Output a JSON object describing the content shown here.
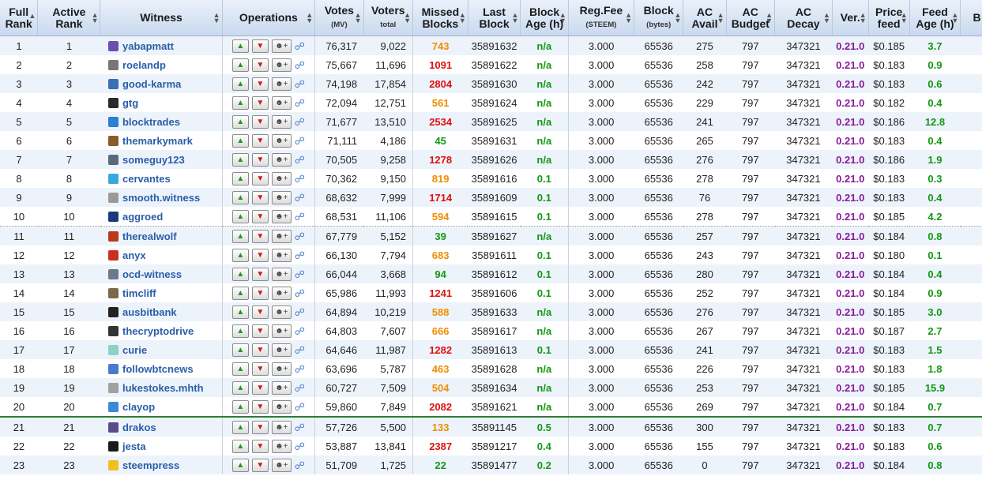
{
  "headers": [
    {
      "l1": "Full",
      "l2": "Rank",
      "sub": "",
      "sort": "up"
    },
    {
      "l1": "Active",
      "l2": "Rank",
      "sub": "",
      "sort": "both"
    },
    {
      "l1": "Witness",
      "l2": "",
      "sub": "",
      "sort": "both"
    },
    {
      "l1": "Operations",
      "l2": "",
      "sub": "",
      "sort": "both"
    },
    {
      "l1": "Votes",
      "l2": "",
      "sub": "(MV)",
      "sort": "both"
    },
    {
      "l1": "Voters",
      "l2": "",
      "sub": "total",
      "sort": "both"
    },
    {
      "l1": "Missed",
      "l2": "Blocks",
      "sub": "",
      "sort": "both"
    },
    {
      "l1": "Last",
      "l2": "Block",
      "sub": "",
      "sort": "both"
    },
    {
      "l1": "Block",
      "l2": "Age (h)",
      "sub": "",
      "sort": "both"
    },
    {
      "l1": "Reg.Fee",
      "l2": "",
      "sub": "(STEEM)",
      "sort": "both"
    },
    {
      "l1": "Block",
      "l2": "",
      "sub": "(bytes)",
      "sort": "both"
    },
    {
      "l1": "AC",
      "l2": "Avail",
      "sub": "",
      "sort": "both"
    },
    {
      "l1": "AC",
      "l2": "Budget",
      "sub": "",
      "sort": "both"
    },
    {
      "l1": "AC",
      "l2": "Decay",
      "sub": "",
      "sort": "both"
    },
    {
      "l1": "Ver.",
      "l2": "",
      "sub": "",
      "sort": "both"
    },
    {
      "l1": "Price",
      "l2": "feed",
      "sub": "",
      "sort": "both"
    },
    {
      "l1": "Feed",
      "l2": "Age (h)",
      "sub": "",
      "sort": "both"
    },
    {
      "l1": "B",
      "l2": "",
      "sub": "",
      "sort": ""
    }
  ],
  "colors": {
    "missed_orange": "#f08c00",
    "missed_red": "#e01010",
    "missed_green": "#129812",
    "version": "#8a1a9a",
    "link": "#2a5ea8"
  },
  "rows": [
    {
      "full": "1",
      "active": "1",
      "witness": "yabapmatt",
      "icon": "#6a4fb0",
      "votes": "76,317",
      "voters": "9,022",
      "missed": "743",
      "mc": "orange",
      "last": "35891632",
      "age": "n/a",
      "fee": "3.000",
      "block": "65536",
      "avail": "275",
      "budget": "797",
      "decay": "347321",
      "ver": "0.21.0",
      "price": "$0.185",
      "feed": "3.7"
    },
    {
      "full": "2",
      "active": "2",
      "witness": "roelandp",
      "icon": "#777777",
      "votes": "75,667",
      "voters": "11,696",
      "missed": "1091",
      "mc": "red",
      "last": "35891622",
      "age": "n/a",
      "fee": "3.000",
      "block": "65536",
      "avail": "258",
      "budget": "797",
      "decay": "347321",
      "ver": "0.21.0",
      "price": "$0.183",
      "feed": "0.9"
    },
    {
      "full": "3",
      "active": "3",
      "witness": "good-karma",
      "icon": "#3a6fb8",
      "votes": "74,198",
      "voters": "17,854",
      "missed": "2804",
      "mc": "red",
      "last": "35891630",
      "age": "n/a",
      "fee": "3.000",
      "block": "65536",
      "avail": "242",
      "budget": "797",
      "decay": "347321",
      "ver": "0.21.0",
      "price": "$0.183",
      "feed": "0.6"
    },
    {
      "full": "4",
      "active": "4",
      "witness": "gtg",
      "icon": "#2a2a2a",
      "votes": "72,094",
      "voters": "12,751",
      "missed": "561",
      "mc": "orange",
      "last": "35891624",
      "age": "n/a",
      "fee": "3.000",
      "block": "65536",
      "avail": "229",
      "budget": "797",
      "decay": "347321",
      "ver": "0.21.0",
      "price": "$0.182",
      "feed": "0.4"
    },
    {
      "full": "5",
      "active": "5",
      "witness": "blocktrades",
      "icon": "#2d7fd2",
      "votes": "71,677",
      "voters": "13,510",
      "missed": "2534",
      "mc": "red",
      "last": "35891625",
      "age": "n/a",
      "fee": "3.000",
      "block": "65536",
      "avail": "241",
      "budget": "797",
      "decay": "347321",
      "ver": "0.21.0",
      "price": "$0.186",
      "feed": "12.8"
    },
    {
      "full": "6",
      "active": "6",
      "witness": "themarkymark",
      "icon": "#8a5a2a",
      "votes": "71,111",
      "voters": "4,186",
      "missed": "45",
      "mc": "green",
      "last": "35891631",
      "age": "n/a",
      "fee": "3.000",
      "block": "65536",
      "avail": "265",
      "budget": "797",
      "decay": "347321",
      "ver": "0.21.0",
      "price": "$0.183",
      "feed": "0.4"
    },
    {
      "full": "7",
      "active": "7",
      "witness": "someguy123",
      "icon": "#5a6a7a",
      "votes": "70,505",
      "voters": "9,258",
      "missed": "1278",
      "mc": "red",
      "last": "35891626",
      "age": "n/a",
      "fee": "3.000",
      "block": "65536",
      "avail": "276",
      "budget": "797",
      "decay": "347321",
      "ver": "0.21.0",
      "price": "$0.186",
      "feed": "1.9"
    },
    {
      "full": "8",
      "active": "8",
      "witness": "cervantes",
      "icon": "#3aa8e0",
      "votes": "70,362",
      "voters": "9,150",
      "missed": "819",
      "mc": "orange",
      "last": "35891616",
      "age": "0.1",
      "fee": "3.000",
      "block": "65536",
      "avail": "278",
      "budget": "797",
      "decay": "347321",
      "ver": "0.21.0",
      "price": "$0.183",
      "feed": "0.3"
    },
    {
      "full": "9",
      "active": "9",
      "witness": "smooth.witness",
      "icon": "#9a9a9a",
      "votes": "68,632",
      "voters": "7,999",
      "missed": "1714",
      "mc": "red",
      "last": "35891609",
      "age": "0.1",
      "fee": "3.000",
      "block": "65536",
      "avail": "76",
      "budget": "797",
      "decay": "347321",
      "ver": "0.21.0",
      "price": "$0.183",
      "feed": "0.4"
    },
    {
      "full": "10",
      "active": "10",
      "witness": "aggroed",
      "icon": "#1a3a7a",
      "votes": "68,531",
      "voters": "11,106",
      "missed": "594",
      "mc": "orange",
      "last": "35891615",
      "age": "0.1",
      "fee": "3.000",
      "block": "65536",
      "avail": "278",
      "budget": "797",
      "decay": "347321",
      "ver": "0.21.0",
      "price": "$0.185",
      "feed": "4.2"
    },
    {
      "full": "11",
      "active": "11",
      "witness": "therealwolf",
      "icon": "#b83a1a",
      "votes": "67,779",
      "voters": "5,152",
      "missed": "39",
      "mc": "green",
      "last": "35891627",
      "age": "n/a",
      "fee": "3.000",
      "block": "65536",
      "avail": "257",
      "budget": "797",
      "decay": "347321",
      "ver": "0.21.0",
      "price": "$0.184",
      "feed": "0.8"
    },
    {
      "full": "12",
      "active": "12",
      "witness": "anyx",
      "icon": "#c83020",
      "votes": "66,130",
      "voters": "7,794",
      "missed": "683",
      "mc": "orange",
      "last": "35891611",
      "age": "0.1",
      "fee": "3.000",
      "block": "65536",
      "avail": "243",
      "budget": "797",
      "decay": "347321",
      "ver": "0.21.0",
      "price": "$0.180",
      "feed": "0.1"
    },
    {
      "full": "13",
      "active": "13",
      "witness": "ocd-witness",
      "icon": "#6a7a8a",
      "votes": "66,044",
      "voters": "3,668",
      "missed": "94",
      "mc": "green",
      "last": "35891612",
      "age": "0.1",
      "fee": "3.000",
      "block": "65536",
      "avail": "280",
      "budget": "797",
      "decay": "347321",
      "ver": "0.21.0",
      "price": "$0.184",
      "feed": "0.4"
    },
    {
      "full": "14",
      "active": "14",
      "witness": "timcliff",
      "icon": "#7a6a4a",
      "votes": "65,986",
      "voters": "11,993",
      "missed": "1241",
      "mc": "red",
      "last": "35891606",
      "age": "0.1",
      "fee": "3.000",
      "block": "65536",
      "avail": "252",
      "budget": "797",
      "decay": "347321",
      "ver": "0.21.0",
      "price": "$0.184",
      "feed": "0.9"
    },
    {
      "full": "15",
      "active": "15",
      "witness": "ausbitbank",
      "icon": "#222222",
      "votes": "64,894",
      "voters": "10,219",
      "missed": "588",
      "mc": "orange",
      "last": "35891633",
      "age": "n/a",
      "fee": "3.000",
      "block": "65536",
      "avail": "276",
      "budget": "797",
      "decay": "347321",
      "ver": "0.21.0",
      "price": "$0.185",
      "feed": "3.0"
    },
    {
      "full": "16",
      "active": "16",
      "witness": "thecryptodrive",
      "icon": "#333333",
      "votes": "64,803",
      "voters": "7,607",
      "missed": "666",
      "mc": "orange",
      "last": "35891617",
      "age": "n/a",
      "fee": "3.000",
      "block": "65536",
      "avail": "267",
      "budget": "797",
      "decay": "347321",
      "ver": "0.21.0",
      "price": "$0.187",
      "feed": "2.7"
    },
    {
      "full": "17",
      "active": "17",
      "witness": "curie",
      "icon": "#8fd0c8",
      "votes": "64,646",
      "voters": "11,987",
      "missed": "1282",
      "mc": "red",
      "last": "35891613",
      "age": "0.1",
      "fee": "3.000",
      "block": "65536",
      "avail": "241",
      "budget": "797",
      "decay": "347321",
      "ver": "0.21.0",
      "price": "$0.183",
      "feed": "1.5"
    },
    {
      "full": "18",
      "active": "18",
      "witness": "followbtcnews",
      "icon": "#4a7ad0",
      "votes": "63,696",
      "voters": "5,787",
      "missed": "463",
      "mc": "orange",
      "last": "35891628",
      "age": "n/a",
      "fee": "3.000",
      "block": "65536",
      "avail": "226",
      "budget": "797",
      "decay": "347321",
      "ver": "0.21.0",
      "price": "$0.183",
      "feed": "1.8"
    },
    {
      "full": "19",
      "active": "19",
      "witness": "lukestokes.mhth",
      "icon": "#a0a0a0",
      "votes": "60,727",
      "voters": "7,509",
      "missed": "504",
      "mc": "orange",
      "last": "35891634",
      "age": "n/a",
      "fee": "3.000",
      "block": "65536",
      "avail": "253",
      "budget": "797",
      "decay": "347321",
      "ver": "0.21.0",
      "price": "$0.185",
      "feed": "15.9"
    },
    {
      "full": "20",
      "active": "20",
      "witness": "clayop",
      "icon": "#3a8ad8",
      "votes": "59,860",
      "voters": "7,849",
      "missed": "2082",
      "mc": "red",
      "last": "35891621",
      "age": "n/a",
      "fee": "3.000",
      "block": "65536",
      "avail": "269",
      "budget": "797",
      "decay": "347321",
      "ver": "0.21.0",
      "price": "$0.184",
      "feed": "0.7"
    },
    {
      "full": "21",
      "active": "21",
      "witness": "drakos",
      "icon": "#5a4a8a",
      "votes": "57,726",
      "voters": "5,500",
      "missed": "133",
      "mc": "orange",
      "last": "35891145",
      "age": "0.5",
      "fee": "3.000",
      "block": "65536",
      "avail": "300",
      "budget": "797",
      "decay": "347321",
      "ver": "0.21.0",
      "price": "$0.183",
      "feed": "0.7"
    },
    {
      "full": "22",
      "active": "22",
      "witness": "jesta",
      "icon": "#1a1a1a",
      "votes": "53,887",
      "voters": "13,841",
      "missed": "2387",
      "mc": "red",
      "last": "35891217",
      "age": "0.4",
      "fee": "3.000",
      "block": "65536",
      "avail": "155",
      "budget": "797",
      "decay": "347321",
      "ver": "0.21.0",
      "price": "$0.183",
      "feed": "0.6"
    },
    {
      "full": "23",
      "active": "23",
      "witness": "steempress",
      "icon": "#f0c020",
      "votes": "51,709",
      "voters": "1,725",
      "missed": "22",
      "mc": "green",
      "last": "35891477",
      "age": "0.2",
      "fee": "3.000",
      "block": "65536",
      "avail": "0",
      "budget": "797",
      "decay": "347321",
      "ver": "0.21.0",
      "price": "$0.184",
      "feed": "0.8"
    }
  ]
}
